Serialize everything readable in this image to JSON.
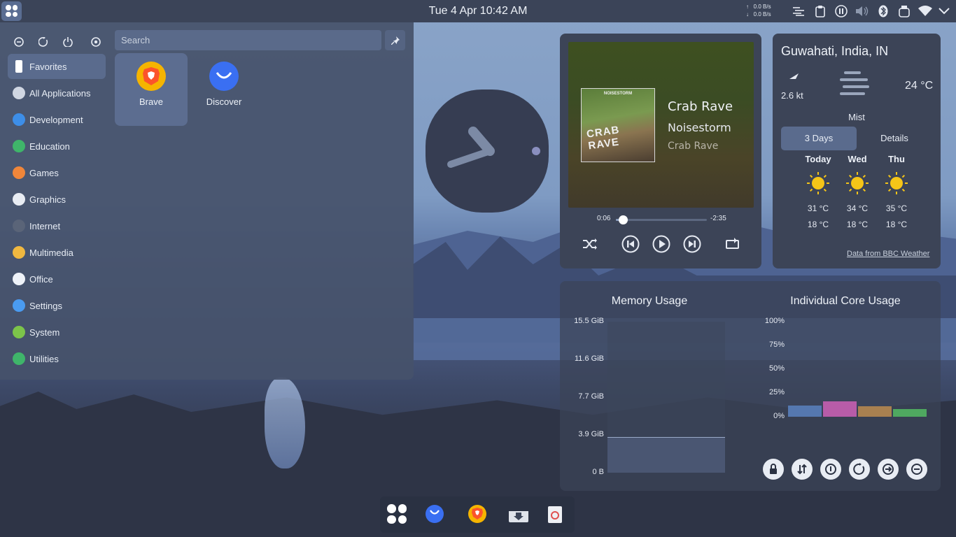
{
  "topbar": {
    "datetime": "Tue 4 Apr 10:42 AM",
    "net_up": "0.0 B/s",
    "net_down": "0.0 B/s",
    "tray_icons": [
      "activity-icon",
      "clipboard-icon",
      "pause-icon",
      "volume-icon",
      "bluetooth-icon",
      "storage-icon",
      "wifi-icon"
    ]
  },
  "menu": {
    "search_placeholder": "Search",
    "categories": [
      {
        "label": "Favorites",
        "color": "#ffffff"
      },
      {
        "label": "All Applications",
        "color": "#d0d6e2"
      },
      {
        "label": "Development",
        "color": "#3d8ee8"
      },
      {
        "label": "Education",
        "color": "#3fb56a"
      },
      {
        "label": "Games",
        "color": "#f0863a"
      },
      {
        "label": "Graphics",
        "color": "#e8ecf3"
      },
      {
        "label": "Internet",
        "color": "#5a6478"
      },
      {
        "label": "Multimedia",
        "color": "#f0b840"
      },
      {
        "label": "Office",
        "color": "#eef2f8"
      },
      {
        "label": "Settings",
        "color": "#4a9bf0"
      },
      {
        "label": "System",
        "color": "#7cc44a"
      },
      {
        "label": "Utilities",
        "color": "#3fb56a"
      }
    ],
    "apps": [
      {
        "label": "Brave",
        "color": "#f5b400"
      },
      {
        "label": "Discover",
        "color": "#3a6ff2"
      }
    ]
  },
  "media": {
    "cover_brand": "NOISESTORM",
    "cover_title": "CRAB RAVE",
    "title": "Crab Rave",
    "artist": "Noisestorm",
    "album": "Crab Rave",
    "elapsed": "0:06",
    "remaining": "-2:35",
    "progress": 0.04
  },
  "weather": {
    "location": "Guwahati, India, IN",
    "wind": "2.6 kt",
    "temp": "24 °C",
    "condition": "Mist",
    "tabs": [
      "3 Days",
      "Details"
    ],
    "days": [
      {
        "name": "Today",
        "high": "31 °C",
        "low": "18 °C"
      },
      {
        "name": "Wed",
        "high": "34 °C",
        "low": "18 °C"
      },
      {
        "name": "Thu",
        "high": "35 °C",
        "low": "18 °C"
      }
    ],
    "source": "Data from BBC Weather"
  },
  "sysmon": {
    "memory_title": "Memory Usage",
    "memory_ticks": [
      "15.5 GiB",
      "11.6 GiB",
      "7.7 GiB",
      "3.9 GiB",
      "0 B"
    ],
    "memory_used_gib": 3.6,
    "memory_max_gib": 15.5,
    "cores_title": "Individual Core Usage",
    "core_ticks": [
      "100%",
      "75%",
      "50%",
      "25%",
      "0%"
    ],
    "cores": [
      {
        "value": 12,
        "color": "#5578b0"
      },
      {
        "value": 16,
        "color": "#b85ca8"
      },
      {
        "value": 11,
        "color": "#a88050"
      },
      {
        "value": 8,
        "color": "#4fa860"
      }
    ],
    "actions": [
      "lock-icon",
      "switch-user-icon",
      "shutdown-icon",
      "restart-icon",
      "logout-icon",
      "hibernate-icon"
    ]
  },
  "dock": {
    "items": [
      "app-launcher-icon",
      "discover-icon",
      "brave-icon",
      "downloads-icon",
      "trash-icon"
    ]
  }
}
